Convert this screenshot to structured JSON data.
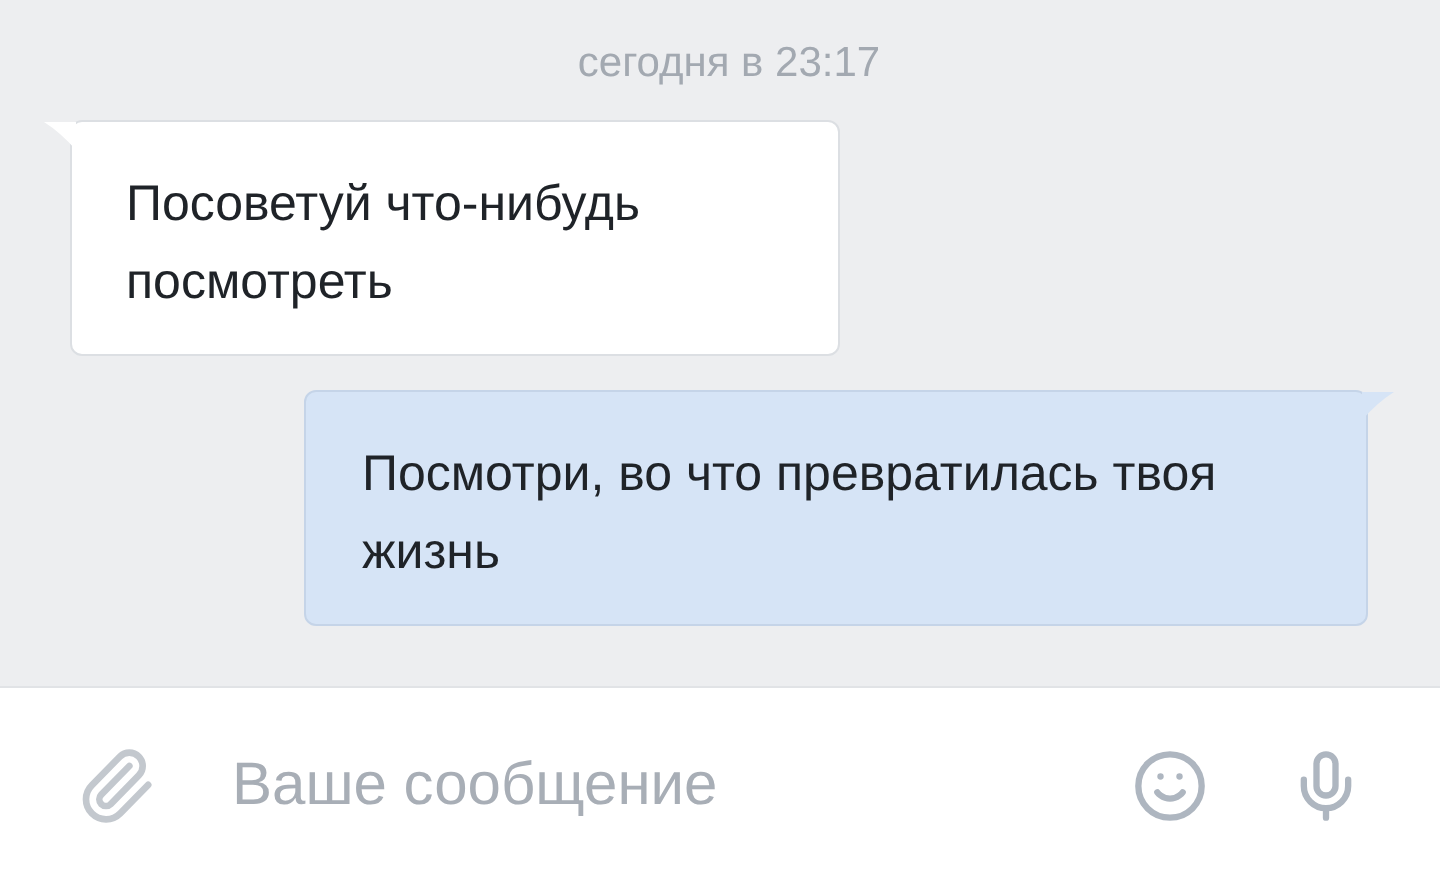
{
  "timestamp": "сегодня в 23:17",
  "messages": [
    {
      "kind": "incoming",
      "text": "Посоветуй что-нибудь посмотреть"
    },
    {
      "kind": "outgoing",
      "text": "Посмотри, во что превратилась твоя жизнь"
    }
  ],
  "composer": {
    "placeholder": "Ваше сообщение"
  }
}
